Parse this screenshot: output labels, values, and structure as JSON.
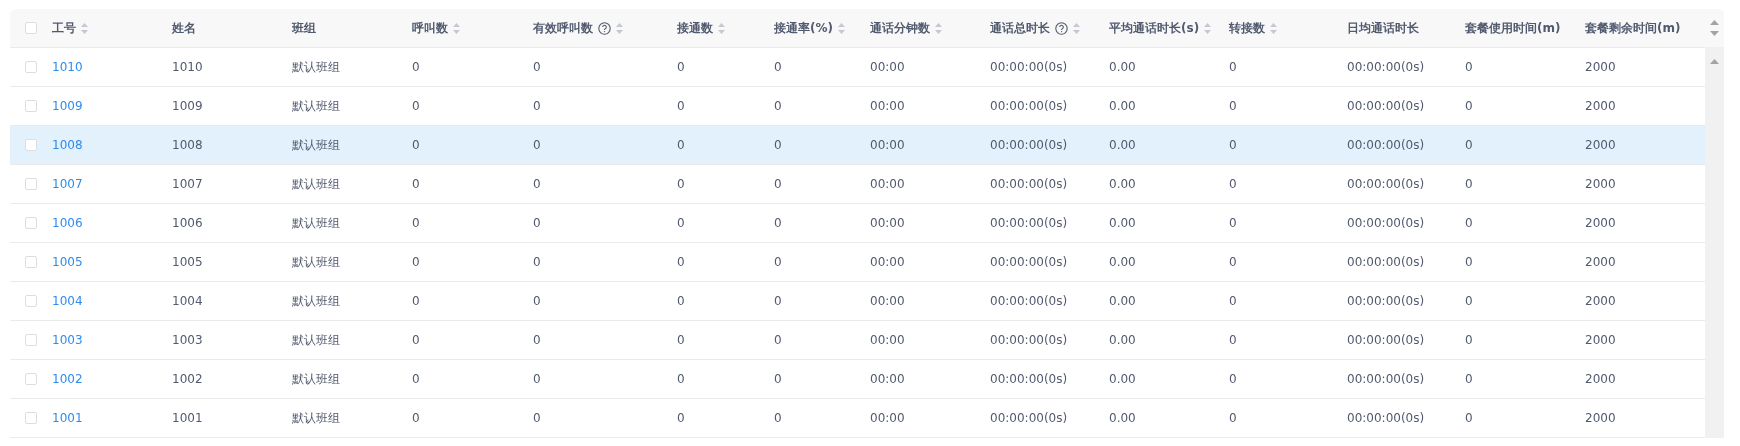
{
  "table": {
    "select_all": {
      "checked": false
    },
    "columns": [
      {
        "label": "工号",
        "sortable": true,
        "help": false
      },
      {
        "label": "姓名",
        "sortable": false,
        "help": false
      },
      {
        "label": "班组",
        "sortable": false,
        "help": false
      },
      {
        "label": "呼叫数",
        "sortable": true,
        "help": false
      },
      {
        "label": "有效呼叫数",
        "sortable": true,
        "help": true
      },
      {
        "label": "接通数",
        "sortable": true,
        "help": false
      },
      {
        "label": "接通率(%)",
        "sortable": true,
        "help": false
      },
      {
        "label": "通话分钟数",
        "sortable": true,
        "help": false
      },
      {
        "label": "通话总时长",
        "sortable": true,
        "help": true
      },
      {
        "label": "平均通话时长(s)",
        "sortable": true,
        "help": false
      },
      {
        "label": "转接数",
        "sortable": true,
        "help": false
      },
      {
        "label": "日均通话时长",
        "sortable": false,
        "help": false
      },
      {
        "label": "套餐使用时间(m)",
        "sortable": false,
        "help": false
      },
      {
        "label": "套餐剩余时间(m)",
        "sortable": false,
        "help": false
      }
    ],
    "rows": [
      {
        "checked": false,
        "hovered": false,
        "cells": [
          "1010",
          "1010",
          "默认班组",
          "0",
          "0",
          "0",
          "0",
          "00:00",
          "00:00:00(0s)",
          "0.00",
          "0",
          "00:00:00(0s)",
          "0",
          "2000"
        ]
      },
      {
        "checked": false,
        "hovered": false,
        "cells": [
          "1009",
          "1009",
          "默认班组",
          "0",
          "0",
          "0",
          "0",
          "00:00",
          "00:00:00(0s)",
          "0.00",
          "0",
          "00:00:00(0s)",
          "0",
          "2000"
        ]
      },
      {
        "checked": false,
        "hovered": true,
        "cells": [
          "1008",
          "1008",
          "默认班组",
          "0",
          "0",
          "0",
          "0",
          "00:00",
          "00:00:00(0s)",
          "0.00",
          "0",
          "00:00:00(0s)",
          "0",
          "2000"
        ]
      },
      {
        "checked": false,
        "hovered": false,
        "cells": [
          "1007",
          "1007",
          "默认班组",
          "0",
          "0",
          "0",
          "0",
          "00:00",
          "00:00:00(0s)",
          "0.00",
          "0",
          "00:00:00(0s)",
          "0",
          "2000"
        ]
      },
      {
        "checked": false,
        "hovered": false,
        "cells": [
          "1006",
          "1006",
          "默认班组",
          "0",
          "0",
          "0",
          "0",
          "00:00",
          "00:00:00(0s)",
          "0.00",
          "0",
          "00:00:00(0s)",
          "0",
          "2000"
        ]
      },
      {
        "checked": false,
        "hovered": false,
        "cells": [
          "1005",
          "1005",
          "默认班组",
          "0",
          "0",
          "0",
          "0",
          "00:00",
          "00:00:00(0s)",
          "0.00",
          "0",
          "00:00:00(0s)",
          "0",
          "2000"
        ]
      },
      {
        "checked": false,
        "hovered": false,
        "cells": [
          "1004",
          "1004",
          "默认班组",
          "0",
          "0",
          "0",
          "0",
          "00:00",
          "00:00:00(0s)",
          "0.00",
          "0",
          "00:00:00(0s)",
          "0",
          "2000"
        ]
      },
      {
        "checked": false,
        "hovered": false,
        "cells": [
          "1003",
          "1003",
          "默认班组",
          "0",
          "0",
          "0",
          "0",
          "00:00",
          "00:00:00(0s)",
          "0.00",
          "0",
          "00:00:00(0s)",
          "0",
          "2000"
        ]
      },
      {
        "checked": false,
        "hovered": false,
        "cells": [
          "1002",
          "1002",
          "默认班组",
          "0",
          "0",
          "0",
          "0",
          "00:00",
          "00:00:00(0s)",
          "0.00",
          "0",
          "00:00:00(0s)",
          "0",
          "2000"
        ]
      },
      {
        "checked": false,
        "hovered": false,
        "cells": [
          "1001",
          "1001",
          "默认班组",
          "0",
          "0",
          "0",
          "0",
          "00:00",
          "00:00:00(0s)",
          "0.00",
          "0",
          "00:00:00(0s)",
          "0",
          "2000"
        ]
      }
    ]
  }
}
